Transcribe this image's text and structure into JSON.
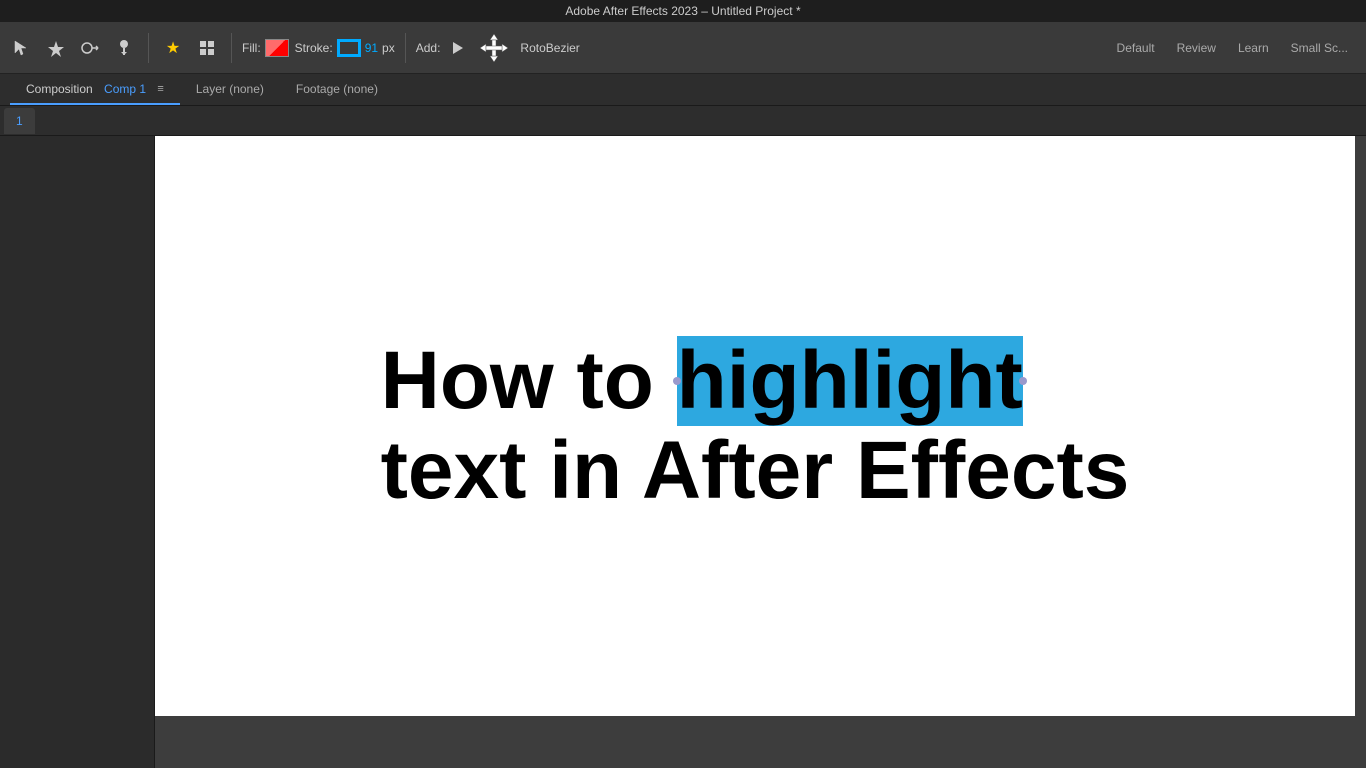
{
  "titleBar": {
    "text": "Adobe After Effects 2023 – Untitled Project *"
  },
  "toolbar": {
    "tools": [
      {
        "name": "selection-tool",
        "icon": "⬛",
        "label": "Selection"
      },
      {
        "name": "pen-tool",
        "icon": "◆",
        "label": "Pen"
      },
      {
        "name": "roto-tool",
        "icon": "🏃",
        "label": "Roto"
      },
      {
        "name": "pin-tool",
        "icon": "📌",
        "label": "Pin"
      }
    ],
    "star_icon": "★",
    "grid_icon": "⊞",
    "fill_label": "Fill:",
    "stroke_label": "Stroke:",
    "stroke_size": "91",
    "stroke_px": "px",
    "add_label": "Add:",
    "rotobezier_label": "RotoBezier",
    "workspaces": [
      "Default",
      "Review",
      "Learn",
      "Small Sc..."
    ]
  },
  "panelHeader": {
    "comp_word": "Composition",
    "comp_name": "Comp 1",
    "menu_icon": "≡",
    "layer_tab": "Layer (none)",
    "footage_tab": "Footage (none)"
  },
  "tabRow": {
    "tab_label": "1"
  },
  "canvas": {
    "line1_prefix": "How to ",
    "line1_highlight": "highlight",
    "line2": "text in After Effects"
  }
}
